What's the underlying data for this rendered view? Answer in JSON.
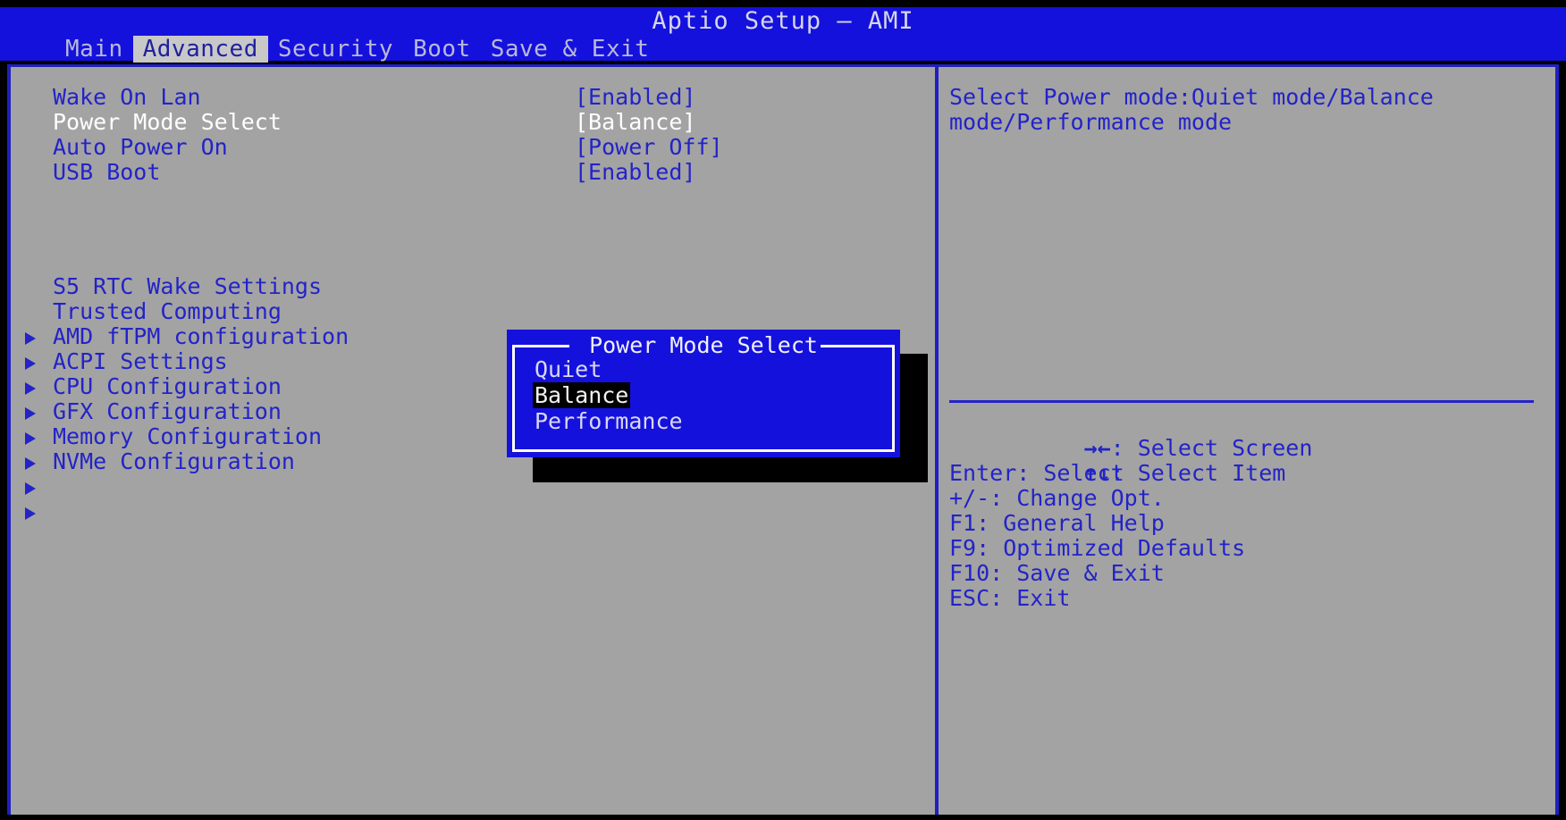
{
  "header": {
    "title": "Aptio Setup – AMI",
    "tabs": [
      {
        "label": "Main",
        "active": false
      },
      {
        "label": "Advanced",
        "active": true
      },
      {
        "label": "Security",
        "active": false
      },
      {
        "label": "Boot",
        "active": false
      },
      {
        "label": "Save & Exit",
        "active": false
      }
    ]
  },
  "settings": [
    {
      "label": "Wake On Lan",
      "value": "[Enabled]",
      "selected": false
    },
    {
      "label": "Power Mode Select",
      "value": "[Balance]",
      "selected": true
    },
    {
      "label": "Auto Power On",
      "value": "[Power Off]",
      "selected": false
    },
    {
      "label": "USB Boot",
      "value": "[Enabled]",
      "selected": false
    }
  ],
  "submenus": [
    {
      "label": "S5 RTC Wake Settings"
    },
    {
      "label": "Trusted Computing"
    },
    {
      "label": "AMD fTPM configuration"
    },
    {
      "label": "ACPI Settings"
    },
    {
      "label": "CPU Configuration"
    },
    {
      "label": "GFX Configuration"
    },
    {
      "label": "Memory Configuration"
    },
    {
      "label": "NVMe Configuration"
    }
  ],
  "help": {
    "text": "Select Power mode:Quiet mode/Balance mode/Performance mode"
  },
  "key_legend": [
    {
      "glyph": "→←",
      "text": ": Select Screen"
    },
    {
      "glyph": "↑↓",
      "text": ": Select Item"
    },
    {
      "glyph": "",
      "text": "Enter: Select"
    },
    {
      "glyph": "",
      "text": "+/-: Change Opt."
    },
    {
      "glyph": "",
      "text": "F1: General Help"
    },
    {
      "glyph": "",
      "text": "F9: Optimized Defaults"
    },
    {
      "glyph": "",
      "text": "F10: Save & Exit"
    },
    {
      "glyph": "",
      "text": "ESC: Exit"
    }
  ],
  "dialog": {
    "title": "Power Mode Select",
    "options": [
      {
        "label": "Quiet",
        "selected": false
      },
      {
        "label": "Balance",
        "selected": true
      },
      {
        "label": "Performance",
        "selected": false
      }
    ]
  },
  "colors": {
    "header_blue": "#1511dd",
    "panel_gray": "#a3a3a3",
    "text_blue": "#2323c8",
    "selected_white": "#ffffff",
    "highlight_black": "#000000"
  }
}
